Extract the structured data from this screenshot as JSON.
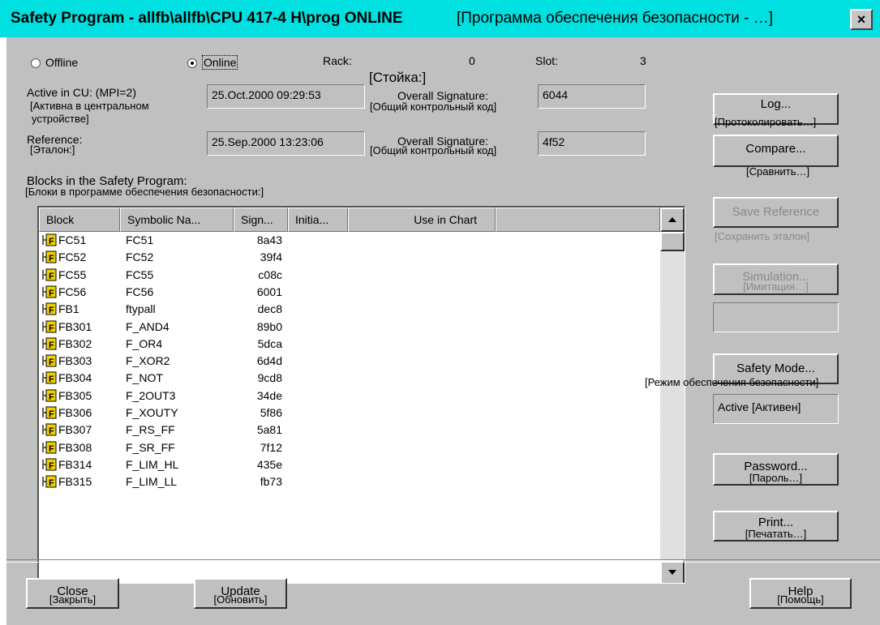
{
  "window": {
    "title": "Safety Program - allfb\\allfb\\CPU 417-4 H\\prog  ONLINE",
    "title_ru": "[Программа обеспечения безопасности - …]",
    "close": "×"
  },
  "mode": {
    "offline": "Offline",
    "online": "Online",
    "selected": "Online"
  },
  "rack": {
    "label": "Rack:",
    "label_ru": "[Стойка:]",
    "value": "0"
  },
  "slot": {
    "label": "Slot:",
    "value": "3"
  },
  "active": {
    "label": "Active in CU: (MPI=2)",
    "label_ru_1": "[Активна в центральном",
    "label_ru_2": "устройстве]",
    "date": "25.Oct.2000 09:29:53",
    "sig_label": "Overall Signature:",
    "sig_label_ru": "[Общий контрольный код]",
    "sig": "6044"
  },
  "reference": {
    "label": "Reference:",
    "label_ru": "[Эталон:]",
    "date": "25.Sep.2000 13:23:06",
    "sig_label": "Overall Signature:",
    "sig_label_ru": "[Общий контрольный код]",
    "sig": "4f52"
  },
  "blocks_label": "Blocks in the Safety Program:",
  "blocks_label_ru": "[Блоки в программе обеспечения безопасности:]",
  "table": {
    "columns": [
      "Block",
      "Symbolic Na...",
      "Sign...",
      "Initia...",
      "Use in Chart"
    ],
    "rows": [
      {
        "block": "FC51",
        "symbol": "FC51",
        "sign": "8a43"
      },
      {
        "block": "FC52",
        "symbol": "FC52",
        "sign": "39f4"
      },
      {
        "block": "FC55",
        "symbol": "FC55",
        "sign": "c08c"
      },
      {
        "block": "FC56",
        "symbol": "FC56",
        "sign": "6001"
      },
      {
        "block": "FB1",
        "symbol": "ftypall",
        "sign": "dec8"
      },
      {
        "block": "FB301",
        "symbol": "F_AND4",
        "sign": "89b0"
      },
      {
        "block": "FB302",
        "symbol": "F_OR4",
        "sign": "5dca"
      },
      {
        "block": "FB303",
        "symbol": "F_XOR2",
        "sign": "6d4d"
      },
      {
        "block": "FB304",
        "symbol": "F_NOT",
        "sign": "9cd8"
      },
      {
        "block": "FB305",
        "symbol": "F_2OUT3",
        "sign": "34de"
      },
      {
        "block": "FB306",
        "symbol": "F_XOUTY",
        "sign": "5f86"
      },
      {
        "block": "FB307",
        "symbol": "F_RS_FF",
        "sign": "5a81"
      },
      {
        "block": "FB308",
        "symbol": "F_SR_FF",
        "sign": "7f12"
      },
      {
        "block": "FB314",
        "symbol": "F_LIM_HL",
        "sign": "435e"
      },
      {
        "block": "FB315",
        "symbol": "F_LIM_LL",
        "sign": "fb73"
      }
    ]
  },
  "buttons": {
    "log": "Log...",
    "log_ru": "[Протоколировать…]",
    "compare": "Compare...",
    "compare_ru": "[Сравнить…]",
    "save_ref": "Save Reference",
    "save_ref_ru": "[Сохранить эталон]",
    "simulation": "Simulation...",
    "simulation_ru": "[Имитация…]",
    "safety_mode": "Safety Mode...",
    "safety_mode_ru": "[Режим обеспечения безопасности]",
    "safety_status": "Active  [Активен]",
    "password": "Password...",
    "password_ru": "[Пароль…]",
    "print": "Print...",
    "print_ru": "[Печатать…]",
    "close": "Close",
    "close_ru": "[Закрыть]",
    "update": "Update",
    "update_ru": "[Обновить]",
    "help": "Help",
    "help_ru": "[Помощь]"
  },
  "icons": {
    "block_icon": "f-block-icon",
    "scroll_up": "arrow-up-icon",
    "scroll_down": "arrow-down-icon"
  }
}
